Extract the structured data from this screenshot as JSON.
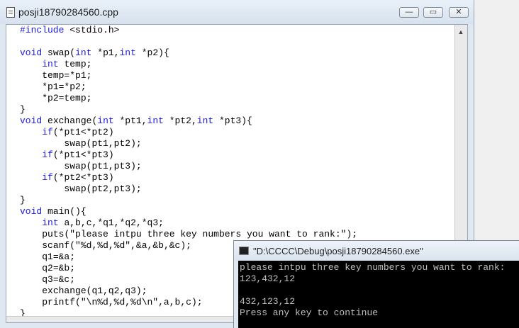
{
  "editor": {
    "title": "posji18790284560.cpp",
    "min_symbol": "—",
    "max_symbol": "▭",
    "close_symbol": "✕",
    "lines": [
      "#include <stdio.h>",
      "",
      "void swap(int *p1,int *p2){",
      "    int temp;",
      "    temp=*p1;",
      "    *p1=*p2;",
      "    *p2=temp;",
      "}",
      "void exchange(int *pt1,int *pt2,int *pt3){",
      "    if(*pt1<*pt2)",
      "        swap(pt1,pt2);",
      "    if(*pt1<*pt3)",
      "        swap(pt1,pt3);",
      "    if(*pt2<*pt3)",
      "        swap(pt2,pt3);",
      "}",
      "void main(){",
      "    int a,b,c,*q1,*q2,*q3;",
      "    puts(\"please intpu three key numbers you want to rank:\");",
      "    scanf(\"%d,%d,%d\",&a,&b,&c);",
      "    q1=&a;",
      "    q2=&b;",
      "    q3=&c;",
      "    exchange(q1,q2,q3);",
      "    printf(\"\\n%d,%d,%d\\n\",a,b,c);",
      "}"
    ],
    "scroll_up_symbol": "▲"
  },
  "console": {
    "title": "\"D:\\CCCC\\Debug\\posji18790284560.exe\"",
    "output": [
      "please intpu three key numbers you want to rank:",
      "123,432,12",
      "",
      "432,123,12",
      "Press any key to continue"
    ]
  },
  "colors": {
    "keyword": "#1a1ae0",
    "console_bg": "#000000",
    "console_text": "#c0c0c0"
  }
}
